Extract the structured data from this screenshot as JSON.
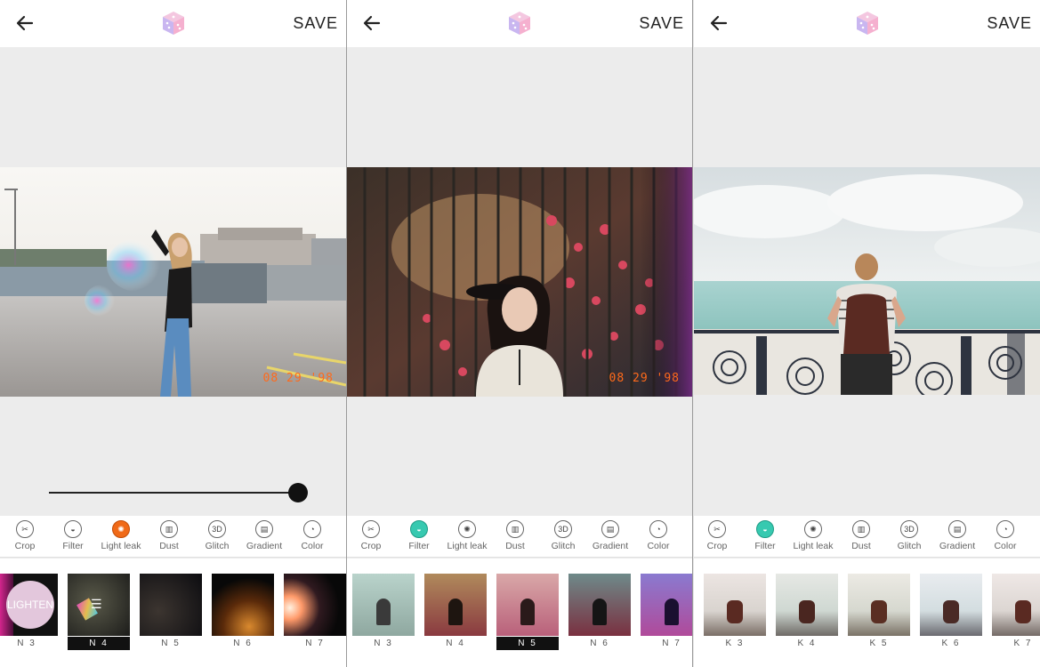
{
  "panels": [
    {
      "save_label": "SAVE",
      "date_stamp": "08 29 '98",
      "slider_value": 0.97,
      "tools": [
        {
          "label": "Crop",
          "icon": "crop-icon",
          "glyph": "✂"
        },
        {
          "label": "Filter",
          "icon": "filter-icon",
          "glyph": "◒"
        },
        {
          "label": "Light leak",
          "icon": "light-leak-icon",
          "glyph": "✺"
        },
        {
          "label": "Dust",
          "icon": "dust-icon",
          "glyph": "▥"
        },
        {
          "label": "Glitch",
          "icon": "glitch-icon",
          "glyph": "3D"
        },
        {
          "label": "Gradient",
          "icon": "gradient-icon",
          "glyph": "▤"
        },
        {
          "label": "Color",
          "icon": "color-icon",
          "glyph": "◔"
        }
      ],
      "active_tool": "Light leak",
      "thumbs": [
        {
          "label": "N 3",
          "badge": "LIGHTEN"
        },
        {
          "label": "N 4",
          "selected": true
        },
        {
          "label": "N 5"
        },
        {
          "label": "N 6"
        },
        {
          "label": "N 7"
        }
      ]
    },
    {
      "save_label": "SAVE",
      "date_stamp": "08 29 '98",
      "tools": [
        {
          "label": "Crop"
        },
        {
          "label": "Filter"
        },
        {
          "label": "Light leak"
        },
        {
          "label": "Dust"
        },
        {
          "label": "Glitch"
        },
        {
          "label": "Gradient"
        },
        {
          "label": "Color"
        }
      ],
      "active_tool": "Filter",
      "thumbs": [
        {
          "label": "N 3"
        },
        {
          "label": "N 4"
        },
        {
          "label": "N 5",
          "selected": true
        },
        {
          "label": "N 6"
        },
        {
          "label": "N 7"
        }
      ]
    },
    {
      "save_label": "SAVE",
      "tools": [
        {
          "label": "Crop"
        },
        {
          "label": "Filter"
        },
        {
          "label": "Light leak"
        },
        {
          "label": "Dust"
        },
        {
          "label": "Glitch"
        },
        {
          "label": "Gradient"
        },
        {
          "label": "Color"
        }
      ],
      "active_tool": "Filter",
      "thumbs": [
        {
          "label": "K 3"
        },
        {
          "label": "K 4"
        },
        {
          "label": "K 5"
        },
        {
          "label": "K 6"
        },
        {
          "label": "K 7"
        }
      ]
    }
  ]
}
